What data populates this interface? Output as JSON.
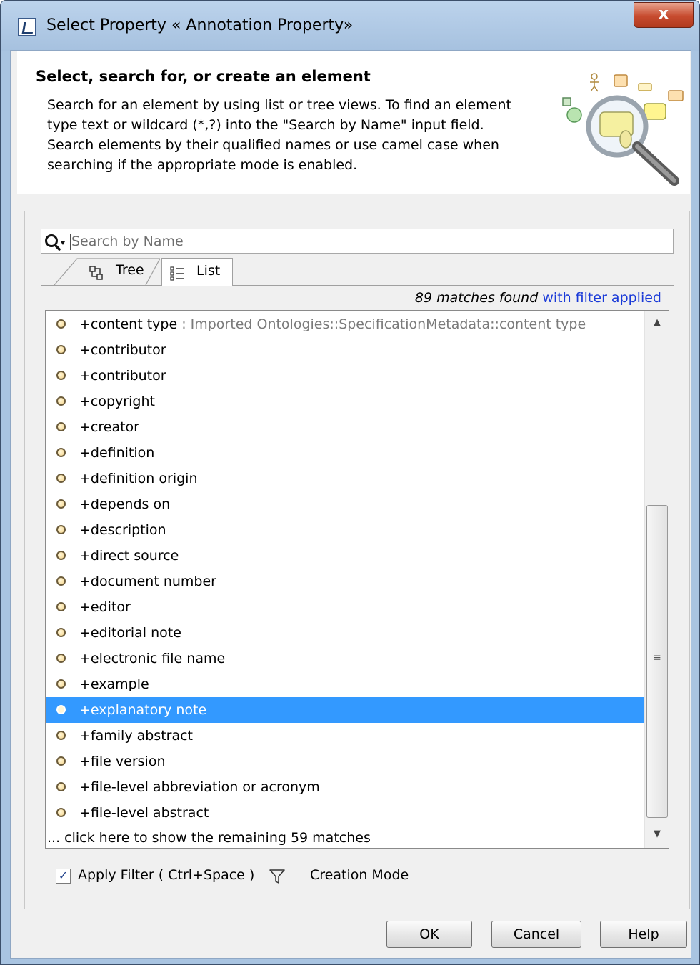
{
  "window": {
    "title": "Select Property « Annotation Property»",
    "close_label": "x"
  },
  "header": {
    "title": "Select, search for, or create an element",
    "description": "Search for an element by using list or tree views. To find an element type text or wildcard (*,?) into the \"Search by Name\" input field. Search elements by their qualified names or use camel case when searching if the appropriate mode is enabled."
  },
  "search": {
    "placeholder": "Search by Name",
    "value": ""
  },
  "tabs": [
    {
      "label": "Tree",
      "active": false
    },
    {
      "label": "List",
      "active": true
    }
  ],
  "results": {
    "count_text": "89 matches found",
    "filter_text": " with filter applied",
    "items": [
      {
        "name": "+content type",
        "path": " : Imported Ontologies::SpecificationMetadata::content type",
        "selected": false
      },
      {
        "name": "+contributor",
        "path": "",
        "selected": false
      },
      {
        "name": "+contributor",
        "path": "",
        "selected": false
      },
      {
        "name": "+copyright",
        "path": "",
        "selected": false
      },
      {
        "name": "+creator",
        "path": "",
        "selected": false
      },
      {
        "name": "+definition",
        "path": "",
        "selected": false
      },
      {
        "name": "+definition origin",
        "path": "",
        "selected": false
      },
      {
        "name": "+depends on",
        "path": "",
        "selected": false
      },
      {
        "name": "+description",
        "path": "",
        "selected": false
      },
      {
        "name": "+direct source",
        "path": "",
        "selected": false
      },
      {
        "name": "+document number",
        "path": "",
        "selected": false
      },
      {
        "name": "+editor",
        "path": "",
        "selected": false
      },
      {
        "name": "+editorial note",
        "path": "",
        "selected": false
      },
      {
        "name": "+electronic file name",
        "path": "",
        "selected": false
      },
      {
        "name": "+example",
        "path": "",
        "selected": false
      },
      {
        "name": "+explanatory note",
        "path": "",
        "selected": true
      },
      {
        "name": "+family abstract",
        "path": "",
        "selected": false
      },
      {
        "name": "+file version",
        "path": "",
        "selected": false
      },
      {
        "name": "+file-level abbreviation or acronym",
        "path": "",
        "selected": false
      },
      {
        "name": "+file-level abstract",
        "path": "",
        "selected": false
      }
    ],
    "more_text": "... click here to show the remaining 59 matches"
  },
  "filter": {
    "checked": true,
    "label": "Apply Filter ( Ctrl+Space )",
    "creation_mode_label": "Creation Mode"
  },
  "buttons": {
    "ok": "OK",
    "cancel": "Cancel",
    "help": "Help"
  },
  "colors": {
    "selection": "#3399ff",
    "link": "#1a3ad8",
    "title_bar": "#a9c4e1"
  }
}
